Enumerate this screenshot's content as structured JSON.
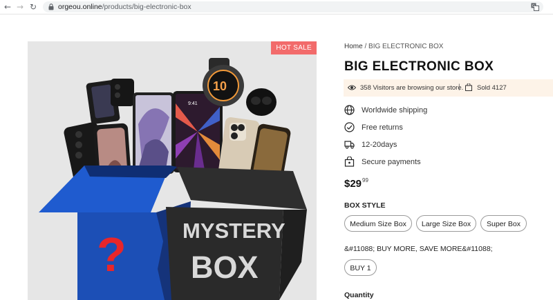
{
  "browser": {
    "url_host": "orgeou.online",
    "url_path": "/products/big-electronic-box"
  },
  "product": {
    "badge": "HOT SALE",
    "image": {
      "box_text_1": "MYSTERY",
      "box_text_2": "BOX",
      "question_mark": "?",
      "watch_text": "10",
      "tablet_time": "9:41"
    },
    "breadcrumb_home": "Home",
    "breadcrumb_sep": " / ",
    "breadcrumb_current": "BIG ELECTRONIC BOX",
    "title": "BIG ELECTRONIC BOX",
    "visitors": "358 Visitors are browsing our store.",
    "separator": "|",
    "sold": "Sold 4127",
    "features": [
      {
        "label": "Worldwide shipping",
        "icon": "globe-icon"
      },
      {
        "label": "Free returns",
        "icon": "check-circle-icon"
      },
      {
        "label": "12-20days",
        "icon": "delivery-truck-icon"
      },
      {
        "label": "Secure payments",
        "icon": "lock-bag-icon"
      }
    ],
    "price_main": "$29",
    "price_cents": "99",
    "box_style_label": "BOX STYLE",
    "box_styles": [
      "Medium Size Box",
      "Large Size Box",
      "Super Box"
    ],
    "promo_label": "&#11088; BUY MORE, SAVE MORE&#11088;",
    "promo_options": [
      "BUY 1"
    ],
    "quantity_label": "Quantity"
  },
  "colors": {
    "badge": "#f26b6b",
    "visitors_bg": "#fdf3e8",
    "box_blue": "#1d4fb8",
    "box_dark": "#2b2b2b"
  }
}
